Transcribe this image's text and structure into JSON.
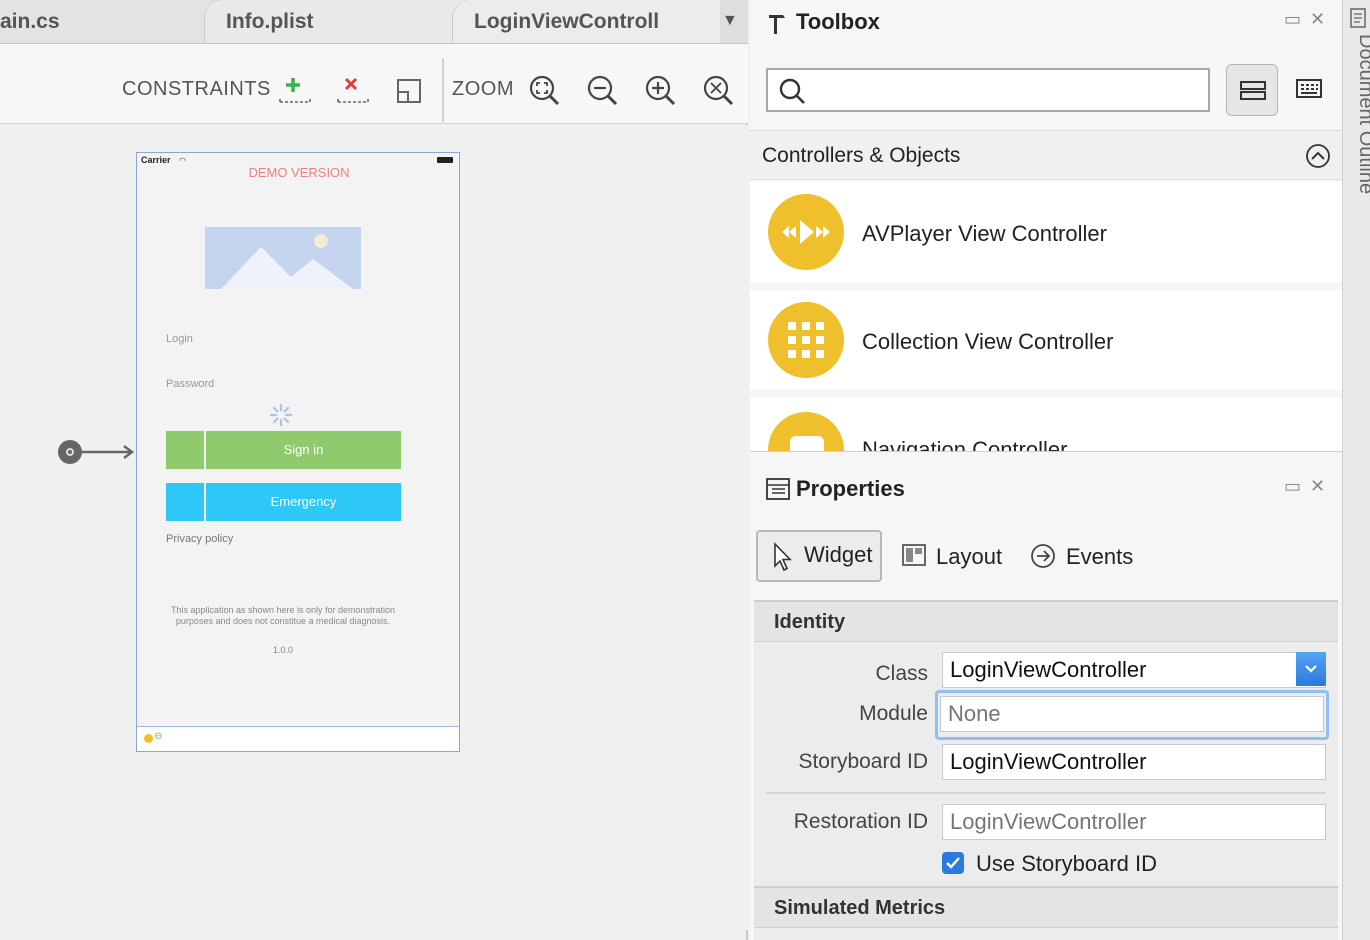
{
  "tabs": [
    {
      "label": "ain.cs"
    },
    {
      "label": "Info.plist"
    },
    {
      "label": "LoginViewControll"
    }
  ],
  "tab_overflow_icon": "triangle-down-icon",
  "toolbar": {
    "constraints_label": "CONSTRAINTS",
    "zoom_label": "ZOOM",
    "icons": [
      "add-constraint-icon",
      "remove-constraint-icon",
      "frame-icon",
      "zoom-fit-icon",
      "zoom-out-icon",
      "zoom-in-icon",
      "zoom-reset-icon"
    ]
  },
  "phone": {
    "carrier": "Carrier",
    "demo_version": "DEMO VERSION",
    "login_placeholder": "Login",
    "password_placeholder": "Password",
    "sign_in": "Sign in",
    "emergency": "Emergency",
    "privacy_policy": "Privacy policy",
    "disclaimer_line1": "This application as shown here is only for demonstration",
    "disclaimer_line2": "purposes and does not constitue a medical diagnosis.",
    "version": "1.0.0",
    "colors": {
      "sign_in": "#8fca6c",
      "emergency": "#2ec8f7",
      "demo": "#f08080",
      "image": "#c5d4ee"
    }
  },
  "toolbox": {
    "title": "Toolbox",
    "section": "Controllers & Objects",
    "items": [
      {
        "label": "AVPlayer View Controller",
        "icon": "avplayer-icon"
      },
      {
        "label": "Collection View Controller",
        "icon": "grid-icon"
      },
      {
        "label": "Navigation Controller",
        "icon": "navigation-icon"
      }
    ],
    "accent": "#f0c02c"
  },
  "properties": {
    "title": "Properties",
    "tabs": [
      {
        "label": "Widget",
        "icon": "cursor-icon"
      },
      {
        "label": "Layout",
        "icon": "layout-icon"
      },
      {
        "label": "Events",
        "icon": "events-arrow-icon"
      }
    ],
    "identity_header": "Identity",
    "class_label": "Class",
    "class_value": "LoginViewController",
    "module_label": "Module",
    "module_placeholder": "None",
    "storyboard_id_label": "Storyboard ID",
    "storyboard_id_value": "LoginViewController",
    "restoration_id_label": "Restoration ID",
    "restoration_id_placeholder": "LoginViewController",
    "use_storyboard_id_label": "Use Storyboard ID",
    "use_storyboard_id_checked": true,
    "simulated_metrics_header": "Simulated Metrics"
  },
  "sidebar": {
    "label": "Document Outline"
  }
}
